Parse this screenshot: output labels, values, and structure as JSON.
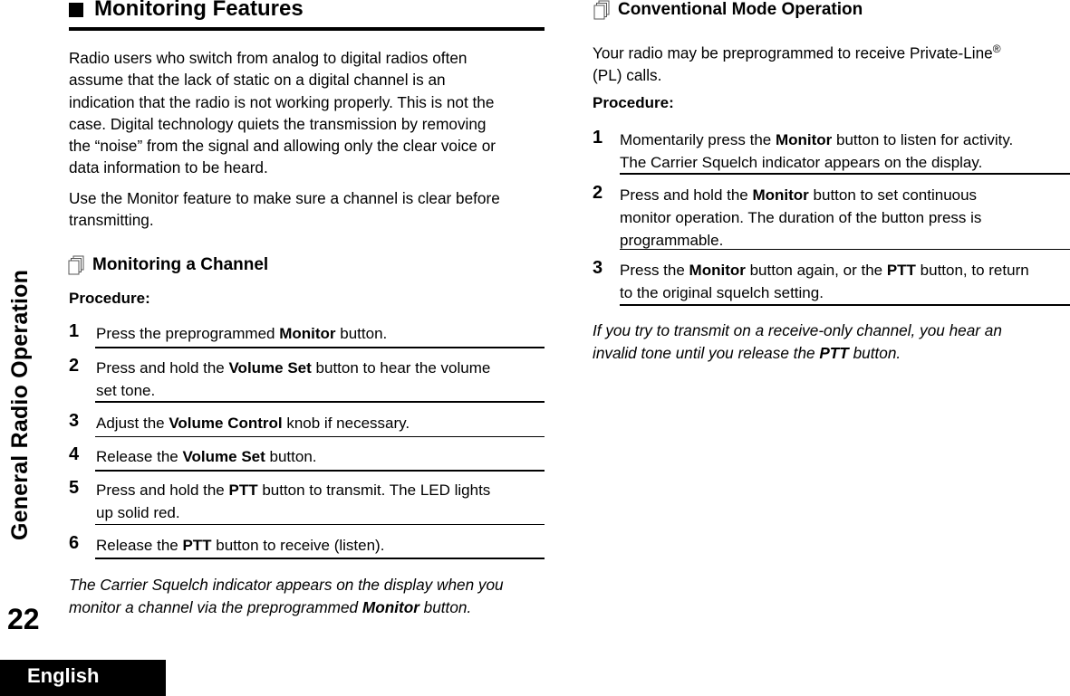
{
  "sidebar": {
    "chapter_title": "General Radio Operation",
    "page_number": "22",
    "language": "English"
  },
  "left": {
    "heading": "Monitoring Features",
    "intro_1": [
      "Radio users who switch from analog to digital radios often",
      "assume that the lack of static on a digital channel is an",
      "indication that the radio is not working properly. This is not the",
      "case. Digital technology quiets the transmission by removing",
      "the “noise” from the signal and allowing only the clear voice or",
      "data information to be heard."
    ],
    "intro_2": [
      "Use the Monitor feature to make sure a channel is clear before",
      "transmitting."
    ],
    "subheading": "Monitoring a Channel",
    "procedure_label": "Procedure:",
    "steps": [
      {
        "num": "1",
        "lines": [
          [
            {
              "t": "Press the preprogrammed "
            },
            {
              "t": "Monitor",
              "b": true
            },
            {
              "t": " button."
            }
          ]
        ]
      },
      {
        "num": "2",
        "lines": [
          [
            {
              "t": "Press and hold the "
            },
            {
              "t": "Volume Set",
              "b": true
            },
            {
              "t": " button to hear the volume"
            }
          ],
          [
            {
              "t": "set tone."
            }
          ]
        ]
      },
      {
        "num": "3",
        "lines": [
          [
            {
              "t": "Adjust the "
            },
            {
              "t": "Volume Control",
              "b": true
            },
            {
              "t": " knob if necessary."
            }
          ]
        ]
      },
      {
        "num": "4",
        "lines": [
          [
            {
              "t": "Release the "
            },
            {
              "t": "Volume Set",
              "b": true
            },
            {
              "t": " button."
            }
          ]
        ]
      },
      {
        "num": "5",
        "lines": [
          [
            {
              "t": "Press and hold the "
            },
            {
              "t": "PTT",
              "b": true
            },
            {
              "t": " button to transmit. The LED lights"
            }
          ],
          [
            {
              "t": "up solid red."
            }
          ]
        ]
      },
      {
        "num": "6",
        "lines": [
          [
            {
              "t": "Release the "
            },
            {
              "t": "PTT",
              "b": true
            },
            {
              "t": " button to receive (listen)."
            }
          ]
        ]
      }
    ],
    "note_lines": [
      [
        {
          "t": "The Carrier Squelch indicator appears on the display when you"
        }
      ],
      [
        {
          "t": "monitor a channel via the preprogrammed "
        },
        {
          "t": "Monitor",
          "b": true
        },
        {
          "t": " button."
        }
      ]
    ]
  },
  "right": {
    "subheading": "Conventional Mode Operation",
    "intro_lines": [
      "Your radio may be preprogrammed to receive Private-Line",
      "(PL) calls."
    ],
    "intro_sup": "®",
    "procedure_label": "Procedure:",
    "steps": [
      {
        "num": "1",
        "lines": [
          [
            {
              "t": "Momentarily press the "
            },
            {
              "t": "Monitor",
              "b": true
            },
            {
              "t": " button to listen for activity."
            }
          ],
          [
            {
              "t": "The Carrier Squelch indicator appears on the display."
            }
          ]
        ]
      },
      {
        "num": "2",
        "lines": [
          [
            {
              "t": "Press and hold the "
            },
            {
              "t": "Monitor",
              "b": true
            },
            {
              "t": " button to set continuous"
            }
          ],
          [
            {
              "t": "monitor operation. The duration of the button press is"
            }
          ],
          [
            {
              "t": "programmable."
            }
          ]
        ]
      },
      {
        "num": "3",
        "lines": [
          [
            {
              "t": "Press the "
            },
            {
              "t": "Monitor",
              "b": true
            },
            {
              "t": " button again, or the "
            },
            {
              "t": "PTT",
              "b": true
            },
            {
              "t": " button, to return"
            }
          ],
          [
            {
              "t": "to the original squelch setting."
            }
          ]
        ]
      }
    ],
    "note_lines": [
      [
        {
          "t": "If you try to transmit on a receive-only channel, you hear an"
        }
      ],
      [
        {
          "t": "invalid tone until you release the "
        },
        {
          "t": "PTT",
          "b": true
        },
        {
          "t": " button."
        }
      ]
    ]
  }
}
